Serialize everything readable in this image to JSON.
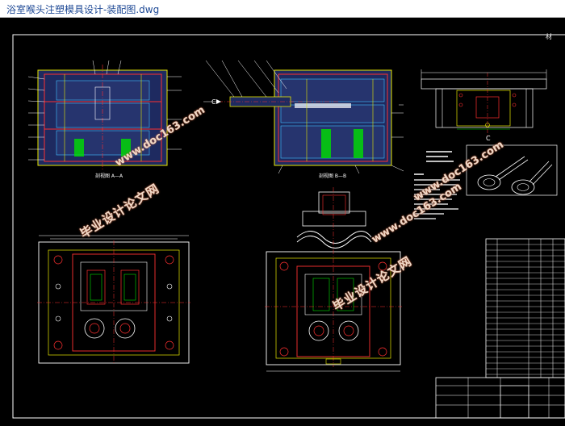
{
  "window": {
    "title": "浴室喉头注塑模具设计-装配图.dwg"
  },
  "drawing": {
    "background": "#000000",
    "line_colors": {
      "yellow": "#e8e800",
      "red": "#ff3030",
      "green": "#00e000",
      "white": "#ffffff",
      "cyan": "#40c0ff",
      "blue_fill": "#2a3a70"
    },
    "section_labels": {
      "left": "剖视图 A—A",
      "right": "剖视图 B—B"
    },
    "corner_label": "材",
    "side_label": "C",
    "detail_label": "C"
  },
  "watermarks": [
    {
      "text": "www.doc163.com",
      "kind": "site"
    },
    {
      "text": "毕业设计论文网",
      "kind": "cn"
    },
    {
      "text": "www.doc163.com",
      "kind": "site"
    },
    {
      "text": "毕业设计论文网",
      "kind": "cn"
    },
    {
      "text": "www.doc163.com",
      "kind": "site"
    }
  ]
}
